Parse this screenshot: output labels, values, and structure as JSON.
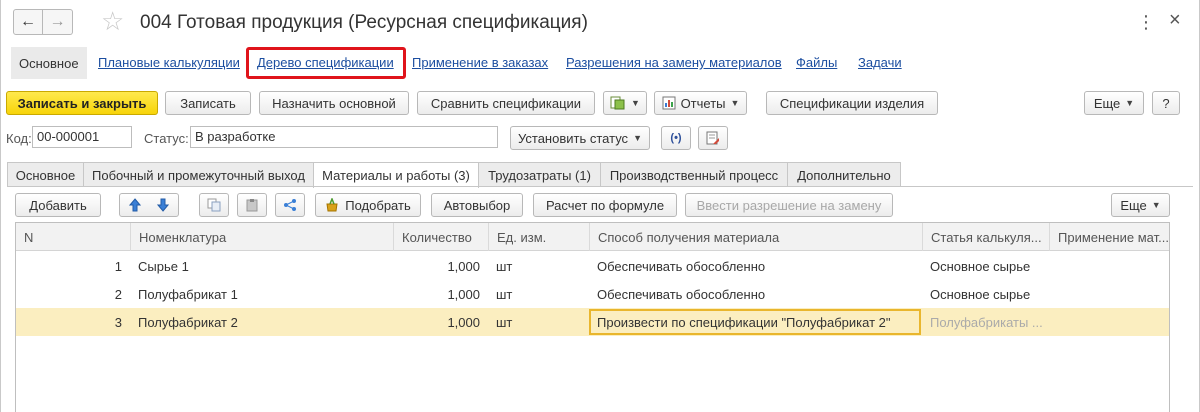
{
  "window": {
    "title": "004 Готовая продукция (Ресурсная спецификация)",
    "back": "←",
    "forward": "→",
    "star": "☆",
    "more": "⋮",
    "close": "×"
  },
  "panel": {
    "active": "Основное",
    "links": [
      "Плановые калькуляции",
      "Дерево спецификации",
      "Применение в заказах",
      "Разрешения на замену материалов",
      "Файлы",
      "Задачи"
    ]
  },
  "toolbar": {
    "save_close": "Записать и закрыть",
    "save": "Записать",
    "set_main": "Назначить основной",
    "compare": "Сравнить спецификации",
    "reports": "Отчеты",
    "item_specs": "Спецификации изделия",
    "more": "Еще",
    "help": "?"
  },
  "fields": {
    "code_label": "Код:",
    "code_value": "00-000001",
    "status_label": "Статус:",
    "status_value": "В разработке",
    "set_status": "Установить статус"
  },
  "tabs": [
    "Основное",
    "Побочный и промежуточный выход",
    "Материалы и работы (3)",
    "Трудозатраты (1)",
    "Производственный процесс",
    "Дополнительно"
  ],
  "table_toolbar": {
    "add": "Добавить",
    "pick": "Подобрать",
    "autoselect": "Автовыбор",
    "formula": "Расчет по формуле",
    "permit": "Ввести разрешение на замену",
    "more": "Еще"
  },
  "table": {
    "columns": [
      "N",
      "Номенклатура",
      "Количество",
      "Ед. изм.",
      "Способ получения материала",
      "Статья калькуля...",
      "Применение мат..."
    ],
    "rows": [
      {
        "n": "1",
        "item": "Сырье 1",
        "qty": "1,000",
        "unit": "шт",
        "method": "Обеспечивать обособленно",
        "article": "Основное сырье",
        "usage": ""
      },
      {
        "n": "2",
        "item": "Полуфабрикат 1",
        "qty": "1,000",
        "unit": "шт",
        "method": "Обеспечивать обособленно",
        "article": "Основное сырье",
        "usage": ""
      },
      {
        "n": "3",
        "item": "Полуфабрикат 2",
        "qty": "1,000",
        "unit": "шт",
        "method": "Произвести по спецификации \"Полуфабрикат 2\"",
        "article": "Полуфабрикаты ...",
        "usage": ""
      }
    ]
  },
  "colors": {
    "primary_button": "#f7d409",
    "link": "#1c4ea0",
    "highlight_box": "#e0141b",
    "selected_row": "#fbeec0"
  }
}
